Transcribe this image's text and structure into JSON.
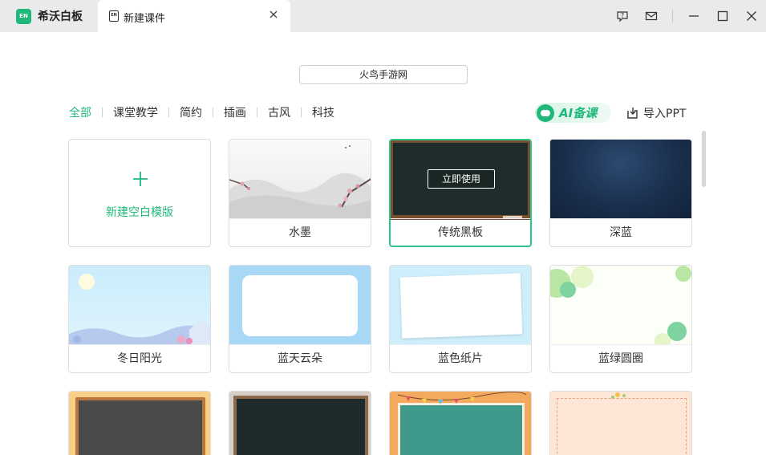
{
  "app": {
    "name": "希沃白板",
    "logo_text": "EN"
  },
  "tab": {
    "icon_text": "EN",
    "label": "新建课件"
  },
  "search": {
    "value": "火鸟手游网"
  },
  "categories": [
    {
      "label": "全部",
      "active": true
    },
    {
      "label": "课堂教学",
      "active": false
    },
    {
      "label": "简约",
      "active": false
    },
    {
      "label": "插画",
      "active": false
    },
    {
      "label": "古风",
      "active": false
    },
    {
      "label": "科技",
      "active": false
    }
  ],
  "ai_button": {
    "label": "AI备课"
  },
  "import_button": {
    "label": "导入PPT"
  },
  "new_template": {
    "label": "新建空白模版"
  },
  "templates": [
    {
      "label": "水墨"
    },
    {
      "label": "传统黑板",
      "selected": true,
      "hover_action": "立即使用"
    },
    {
      "label": "深蓝"
    },
    {
      "label": "冬日阳光"
    },
    {
      "label": "蓝天云朵"
    },
    {
      "label": "蓝色纸片"
    },
    {
      "label": "蓝绿圆圈"
    }
  ],
  "colors": {
    "accent": "#1fb87a",
    "selected_border": "#2ec48a",
    "titlebar": "#e9eaec"
  }
}
